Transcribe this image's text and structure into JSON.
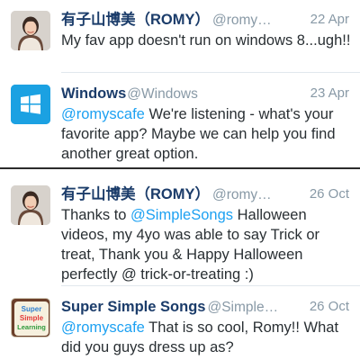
{
  "tweets": [
    {
      "name": "有子山博美（ROMY）",
      "handle": "@romy…",
      "date": "22 Apr",
      "text": "My fav app doesn't run on windows 8...ugh!!"
    },
    {
      "name": "Windows",
      "handle": "@Windows",
      "date": "23 Apr",
      "mention": "@romyscafe",
      "text": " We're listening - what's your favorite app? Maybe we can help you find another great option."
    },
    {
      "name": "有子山博美（ROMY）",
      "handle": "@romy…",
      "date": "26 Oct",
      "text_pre": "Thanks to ",
      "mention": "@SimpleSongs",
      "text": " Halloween videos, my 4yo was able to say Trick or treat, Thank you & Happy Halloween perfectly @ trick-or-treating :)"
    },
    {
      "name": "Super Simple Songs",
      "handle": "@Simple…",
      "date": "26 Oct",
      "mention": "@romyscafe",
      "text": " That is so cool, Romy!! What did you guys dress up as?"
    }
  ],
  "avatars": {
    "romy": "person-photo-avatar",
    "windows": "windows-logo-icon",
    "sss": "super-simple-learning-logo"
  },
  "logo_text": {
    "sss_line1": "Super",
    "sss_line2": "Simple",
    "sss_line3": "Learning"
  },
  "colors": {
    "name": "#1b3c6a",
    "mention": "#1da1f2",
    "meta": "#8899a6",
    "windows_blue": "#1ba1e2"
  }
}
